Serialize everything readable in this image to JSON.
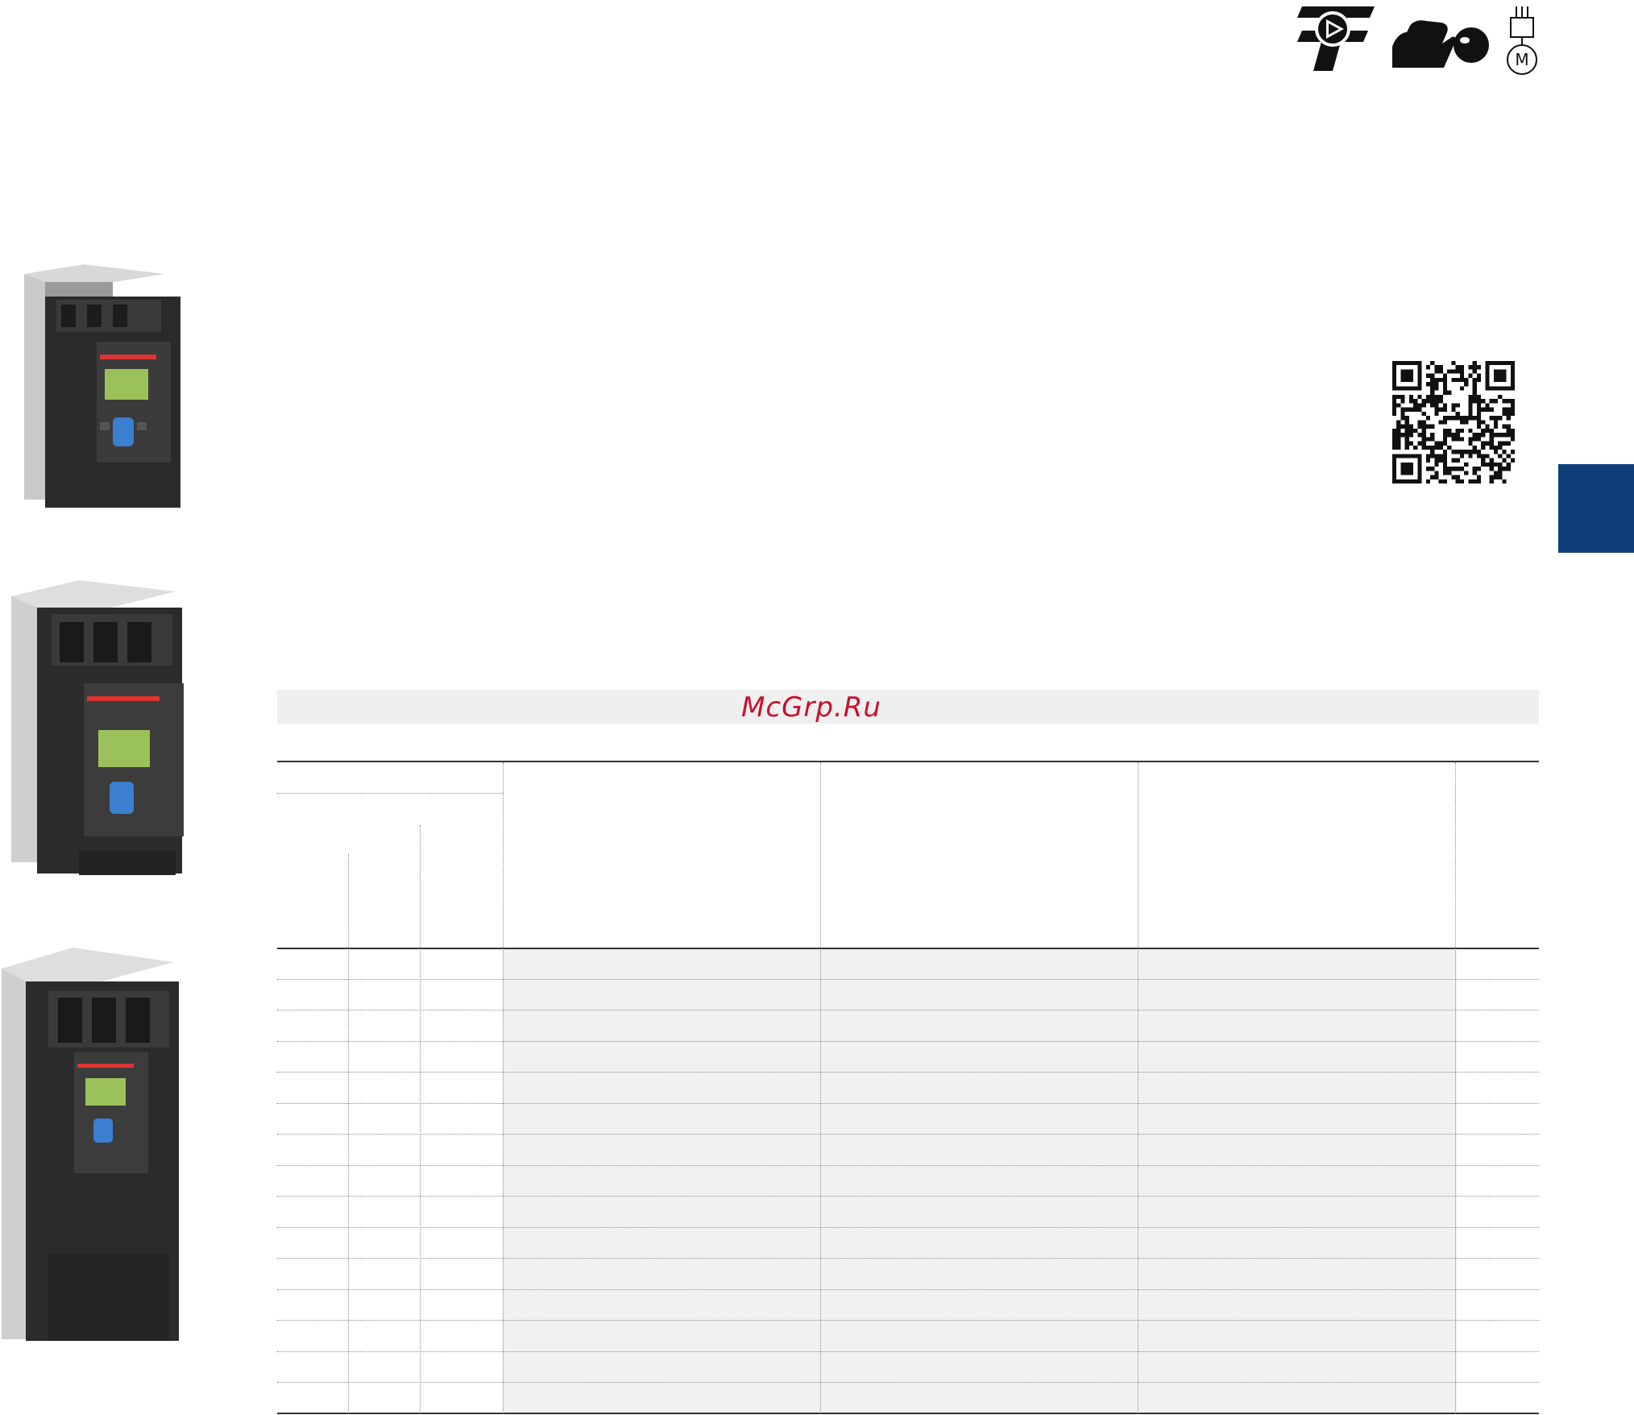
{
  "watermark": {
    "text": "McGrp.Ru"
  },
  "icons": [
    "pump-icon",
    "heavy-duty-icon",
    "motor-icon"
  ],
  "colors": {
    "tab_blue": "#0f3f7a",
    "watermark_red": "#c8102e",
    "band_gray": "#efefef"
  },
  "images": [
    {
      "name": "soft-starter-product-photo-small"
    },
    {
      "name": "soft-starter-product-photo-medium"
    },
    {
      "name": "soft-starter-product-photo-large"
    }
  ]
}
